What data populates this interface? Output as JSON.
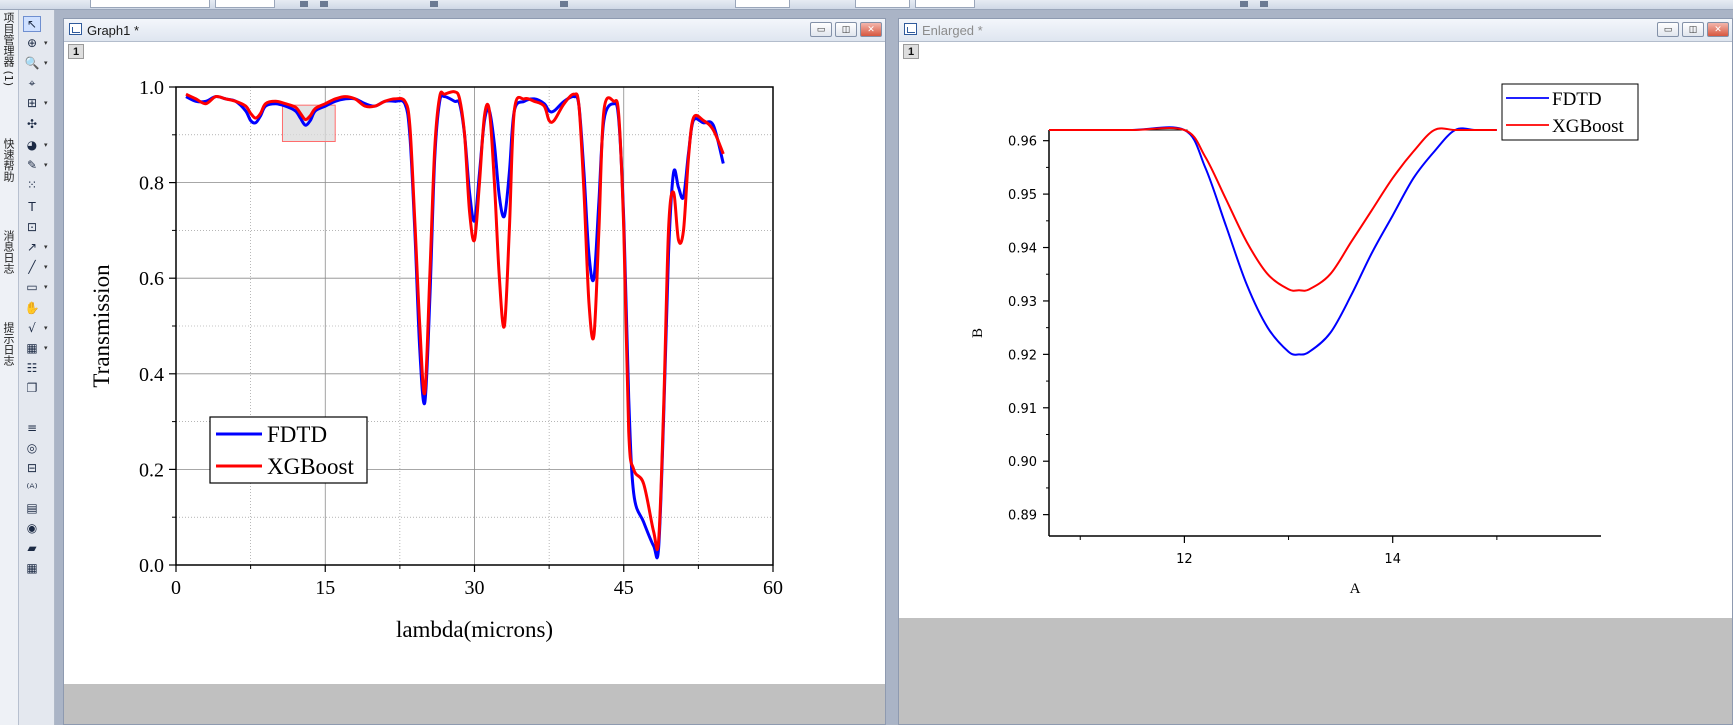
{
  "left_sidebar": {
    "tabs": [
      "项目管理器 (1)",
      "快速帮助",
      "消息日志",
      "提示日志"
    ]
  },
  "tools": [
    {
      "icon": "pointer-icon",
      "glyph": "↖",
      "has_menu": false,
      "active": true
    },
    {
      "icon": "zoom-pan-icon",
      "glyph": "⊕",
      "has_menu": true
    },
    {
      "icon": "zoom-in-icon",
      "glyph": "🔍",
      "has_menu": true
    },
    {
      "icon": "screen-reader-icon",
      "glyph": "⌖",
      "has_menu": false
    },
    {
      "icon": "data-selector-icon",
      "glyph": "⊞",
      "has_menu": true
    },
    {
      "icon": "data-reader-icon",
      "glyph": "✣",
      "has_menu": false
    },
    {
      "icon": "mask-icon",
      "glyph": "◕",
      "has_menu": true
    },
    {
      "icon": "draw-data-icon",
      "glyph": "✎",
      "has_menu": true
    },
    {
      "icon": "region-data-icon",
      "glyph": "⁙",
      "has_menu": false
    },
    {
      "icon": "text-tool-icon",
      "glyph": "T",
      "has_menu": false
    },
    {
      "icon": "annotation-icon",
      "glyph": "⊡",
      "has_menu": false
    },
    {
      "icon": "arrow-tool-icon",
      "glyph": "↗",
      "has_menu": true
    },
    {
      "icon": "line-tool-icon",
      "glyph": "╱",
      "has_menu": true
    },
    {
      "icon": "rectangle-tool-icon",
      "glyph": "▭",
      "has_menu": true
    },
    {
      "icon": "hand-icon",
      "glyph": "✋",
      "has_menu": false
    },
    {
      "icon": "insert-equation-icon",
      "glyph": "√",
      "has_menu": true
    },
    {
      "icon": "insert-graph-icon",
      "glyph": "▦",
      "has_menu": true
    },
    {
      "icon": "insert-table-icon",
      "glyph": "☷",
      "has_menu": false
    },
    {
      "icon": "copy-format-icon",
      "glyph": "❐",
      "has_menu": false
    },
    {
      "icon": "list-icon",
      "glyph": "≡",
      "has_menu": false
    },
    {
      "icon": "circle-icon",
      "glyph": "◎",
      "has_menu": false
    },
    {
      "icon": "layer-icon",
      "glyph": "⊟",
      "has_menu": false
    },
    {
      "icon": "add-text-icon",
      "glyph": "⁽ᴬ⁾",
      "has_menu": false
    },
    {
      "icon": "worksheet-icon",
      "glyph": "▤",
      "has_menu": false
    },
    {
      "icon": "record-icon",
      "glyph": "◉",
      "has_menu": false
    },
    {
      "icon": "folder-icon",
      "glyph": "▰",
      "has_menu": false
    },
    {
      "icon": "grid-icon",
      "glyph": "▦",
      "has_menu": false
    }
  ],
  "windows": {
    "graph1": {
      "title": "Graph1 *",
      "layer": "1",
      "buttons": [
        "▭",
        "◫",
        "✕"
      ]
    },
    "enlarged": {
      "title": "Enlarged *",
      "layer": "1",
      "buttons": [
        "▭",
        "◫",
        "✕"
      ]
    }
  },
  "colors": {
    "fdtd": "#0000ff",
    "xgboost": "#ff0000",
    "grid": "#8a8a8a",
    "selection_fill": "#d9d9d9",
    "selection_stroke": "#ff6b6b"
  },
  "chart_data": [
    {
      "type": "line",
      "title": "",
      "xlabel": "lambda(microns)",
      "ylabel": "Transmission",
      "xlim": [
        0,
        60
      ],
      "ylim": [
        0,
        1.0
      ],
      "x_ticks": [
        0,
        15,
        30,
        45,
        60
      ],
      "y_ticks": [
        0.0,
        0.2,
        0.4,
        0.6,
        0.8,
        1.0
      ],
      "y_tick_labels": [
        "0.0",
        "0.2",
        "0.4",
        "0.6",
        "0.8",
        "1.0"
      ],
      "grid": true,
      "legend_position": "lower-left",
      "zoom_region": {
        "x": [
          10.7,
          16.0
        ],
        "y": [
          0.886,
          0.962
        ]
      },
      "series": [
        {
          "name": "FDTD",
          "x": [
            1,
            2,
            3,
            4,
            5,
            6,
            7,
            7.5,
            8,
            8.5,
            9,
            10,
            11,
            12,
            12.5,
            13,
            13.5,
            14,
            15,
            16,
            17,
            18,
            19,
            20,
            21,
            22,
            23,
            23.5,
            24,
            24.5,
            25,
            25.5,
            26,
            26.5,
            27,
            28,
            28.5,
            29,
            29.5,
            30,
            30.5,
            31,
            31.5,
            32,
            32.5,
            33,
            33.5,
            34,
            35,
            36,
            37,
            37.5,
            38,
            39,
            40,
            40.5,
            41,
            41.5,
            42,
            42.5,
            43,
            44,
            44.5,
            45,
            45.5,
            46,
            47,
            48,
            48.5,
            49,
            49.5,
            50,
            50.5,
            51,
            51.5,
            52,
            53,
            54,
            55
          ],
          "y": [
            0.98,
            0.97,
            0.97,
            0.98,
            0.975,
            0.97,
            0.95,
            0.93,
            0.925,
            0.94,
            0.96,
            0.965,
            0.96,
            0.95,
            0.935,
            0.92,
            0.93,
            0.95,
            0.96,
            0.97,
            0.975,
            0.975,
            0.965,
            0.96,
            0.97,
            0.97,
            0.965,
            0.9,
            0.7,
            0.45,
            0.34,
            0.55,
            0.85,
            0.97,
            0.98,
            0.97,
            0.965,
            0.9,
            0.78,
            0.72,
            0.82,
            0.93,
            0.95,
            0.88,
            0.77,
            0.73,
            0.82,
            0.95,
            0.97,
            0.975,
            0.965,
            0.95,
            0.95,
            0.97,
            0.98,
            0.96,
            0.82,
            0.65,
            0.6,
            0.76,
            0.93,
            0.965,
            0.93,
            0.72,
            0.35,
            0.15,
            0.09,
            0.04,
            0.035,
            0.3,
            0.65,
            0.82,
            0.79,
            0.77,
            0.86,
            0.93,
            0.925,
            0.92,
            0.84
          ]
        },
        {
          "name": "XGBoost",
          "x": [
            1,
            2,
            3,
            4,
            5,
            6,
            7,
            7.5,
            8,
            8.5,
            9,
            10,
            11,
            12,
            12.5,
            13,
            13.5,
            14,
            15,
            16,
            17,
            18,
            19,
            20,
            21,
            22,
            23,
            23.5,
            24,
            24.5,
            25,
            25.5,
            26,
            26.5,
            27,
            28,
            28.5,
            29,
            29.5,
            30,
            30.5,
            31,
            31.5,
            32,
            32.5,
            33,
            33.5,
            34,
            35,
            36,
            37,
            37.5,
            38,
            39,
            40,
            40.5,
            41,
            41.5,
            42,
            42.5,
            43,
            44,
            44.5,
            45,
            45.5,
            46,
            47,
            48,
            48.5,
            49,
            49.5,
            50,
            50.5,
            51,
            51.5,
            52,
            53,
            54,
            55
          ],
          "y": [
            0.985,
            0.975,
            0.965,
            0.98,
            0.975,
            0.97,
            0.96,
            0.945,
            0.935,
            0.945,
            0.965,
            0.97,
            0.965,
            0.958,
            0.945,
            0.932,
            0.94,
            0.955,
            0.965,
            0.975,
            0.98,
            0.975,
            0.96,
            0.96,
            0.97,
            0.975,
            0.97,
            0.92,
            0.72,
            0.5,
            0.36,
            0.6,
            0.87,
            0.98,
            0.985,
            0.99,
            0.975,
            0.9,
            0.74,
            0.68,
            0.8,
            0.94,
            0.95,
            0.8,
            0.6,
            0.5,
            0.7,
            0.95,
            0.975,
            0.97,
            0.96,
            0.93,
            0.93,
            0.965,
            0.985,
            0.96,
            0.78,
            0.55,
            0.48,
            0.7,
            0.95,
            0.97,
            0.94,
            0.7,
            0.28,
            0.2,
            0.17,
            0.07,
            0.05,
            0.32,
            0.7,
            0.78,
            0.68,
            0.7,
            0.85,
            0.935,
            0.93,
            0.91,
            0.86
          ]
        }
      ]
    },
    {
      "type": "line",
      "title": "",
      "xlabel": "A",
      "ylabel": "B",
      "xlim": [
        10.7,
        16.0
      ],
      "ylim": [
        0.886,
        0.962
      ],
      "x_ticks": [
        12,
        14
      ],
      "y_ticks": [
        0.89,
        0.9,
        0.91,
        0.92,
        0.93,
        0.94,
        0.95,
        0.96
      ],
      "y_tick_labels": [
        "0.89",
        "0.90",
        "0.91",
        "0.92",
        "0.93",
        "0.94",
        "0.95",
        "0.96"
      ],
      "grid": false,
      "legend_position": "top-right",
      "series": [
        {
          "name": "FDTD",
          "x": [
            10.7,
            11.0,
            11.5,
            12.0,
            12.2,
            12.4,
            12.6,
            12.8,
            13.0,
            13.1,
            13.2,
            13.4,
            13.6,
            13.8,
            14.0,
            14.2,
            14.4,
            14.6,
            14.8,
            15.0
          ],
          "y": [
            0.962,
            0.962,
            0.962,
            0.962,
            0.955,
            0.944,
            0.933,
            0.925,
            0.9205,
            0.92,
            0.9205,
            0.924,
            0.931,
            0.939,
            0.946,
            0.953,
            0.958,
            0.962,
            0.962,
            0.962
          ]
        },
        {
          "name": "XGBoost",
          "x": [
            10.7,
            11.0,
            11.5,
            12.0,
            12.2,
            12.4,
            12.6,
            12.8,
            13.0,
            13.1,
            13.2,
            13.4,
            13.6,
            13.8,
            14.0,
            14.2,
            14.4,
            14.6,
            14.8,
            15.0
          ],
          "y": [
            0.962,
            0.962,
            0.962,
            0.962,
            0.957,
            0.949,
            0.941,
            0.935,
            0.9322,
            0.932,
            0.9322,
            0.935,
            0.941,
            0.947,
            0.953,
            0.958,
            0.962,
            0.962,
            0.962,
            0.962
          ]
        }
      ]
    }
  ]
}
